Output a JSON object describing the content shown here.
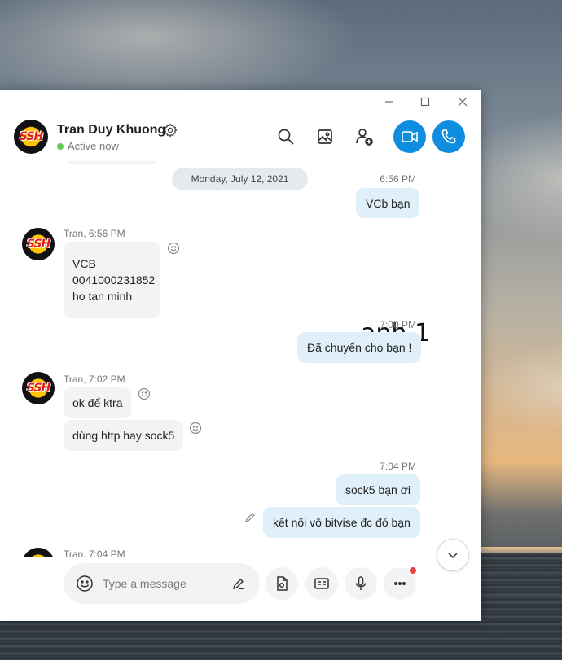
{
  "window": {
    "controls": [
      "minimize",
      "maximize",
      "close"
    ]
  },
  "header": {
    "contact_name": "Tran Duy Khuong",
    "status": "Active now",
    "status_color": "#5fcd4c",
    "accent_color": "#0f8ee0",
    "icons": [
      "gear-icon",
      "search-icon",
      "gallery-icon",
      "add-person-icon",
      "video-call-icon",
      "voice-call-icon"
    ]
  },
  "avatar": {
    "text": "SSH"
  },
  "chat": {
    "date_separator": "Monday, July 12, 2021",
    "overlay_note": "anh 1",
    "groups": [
      {
        "time": "6:56 PM",
        "messages": [
          "VCb bạn"
        ]
      },
      {
        "sender": "Tran, 6:56 PM",
        "lines": [
          "VCB",
          "0041000231852",
          "ho tan minh"
        ]
      },
      {
        "time": "7:00 PM",
        "messages": [
          "Đã chuyển cho bạn !"
        ]
      },
      {
        "sender": "Tran, 7:02 PM",
        "messages": [
          "ok để ktra",
          "dùng http hay sock5"
        ]
      },
      {
        "time": "7:04 PM",
        "messages": [
          "sock5 bạn ơi",
          "kết nối vô bitvise đc đó bạn"
        ]
      },
      {
        "sender": "Tran, 7:04 PM"
      }
    ]
  },
  "composer": {
    "placeholder": "Type a message",
    "icons": [
      "emoji-icon",
      "handwriting-icon",
      "file-icon",
      "contact-card-icon",
      "microphone-icon",
      "more-icon"
    ]
  }
}
